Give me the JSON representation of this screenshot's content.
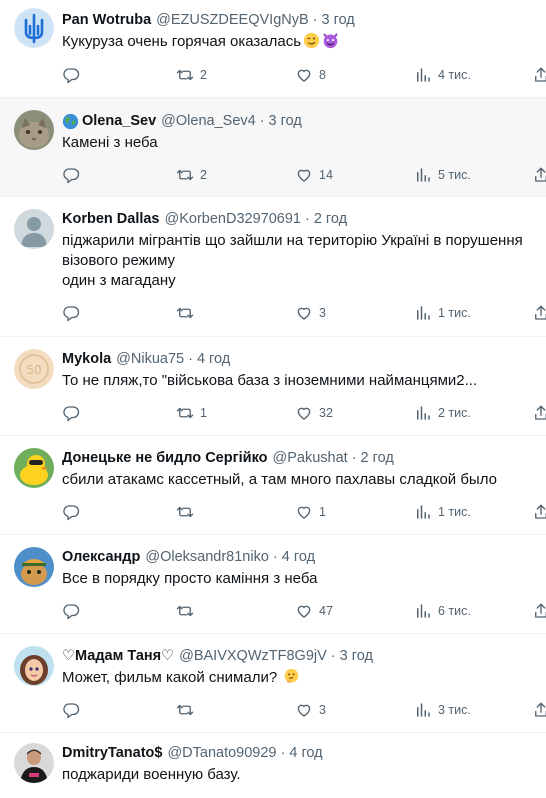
{
  "replies": [
    {
      "name": "Pan Wotruba",
      "handle": "@EZUSZDEEQVIgNyB",
      "time": "3 год",
      "text": "Кукуруза очень горячая оказалась",
      "emojis": [
        "winking-face",
        "smiling-devil"
      ],
      "avatar": "trident-avatar",
      "stats": {
        "replies": "",
        "retweets": "2",
        "likes": "8",
        "views": "4 тис."
      }
    },
    {
      "name": "Olena_Sev",
      "name_prefix_icon": "globe-icon",
      "handle": "@Olena_Sev4",
      "time": "3 год",
      "text": "Камені з неба",
      "avatar": "cat-avatar",
      "stats": {
        "replies": "",
        "retweets": "2",
        "likes": "14",
        "views": "5 тис."
      }
    },
    {
      "name": "Korben Dallas",
      "handle": "@KorbenD32970691",
      "time": "2 год",
      "text": "піджарили мігрантів що зайшли на територію Україні в порушення візового режиму\nодин з магадану",
      "avatar": "default-avatar",
      "stats": {
        "replies": "",
        "retweets": "",
        "likes": "3",
        "views": "1 тис."
      }
    },
    {
      "name": "Mykola",
      "handle": "@Nikua75",
      "time": "4 год",
      "text": "То не пляж,то \"військова база з іноземними найманцями2...",
      "avatar": "coin-avatar",
      "stats": {
        "replies": "",
        "retweets": "1",
        "likes": "32",
        "views": "2 тис."
      }
    },
    {
      "name": "Донецьке не бидло Сергійко",
      "handle": "@Pakushat",
      "time": "2 год",
      "text": "сбили атакамс кассетный, а там много пахлавы сладкой было",
      "avatar": "duck-avatar",
      "stats": {
        "replies": "",
        "retweets": "",
        "likes": "1",
        "views": "1 тис."
      }
    },
    {
      "name": "Олександр",
      "handle": "@Oleksandr81niko",
      "time": "4 год",
      "text": "Все в порядку просто каміння з неба",
      "avatar": "cat-cap-avatar",
      "stats": {
        "replies": "",
        "retweets": "",
        "likes": "47",
        "views": "6 тис."
      }
    },
    {
      "name": "♡Мадам Таня♡",
      "handle": "@BAIVXQWzTF8G9jV",
      "time": "3 год",
      "text": "Может, фильм какой снимали?",
      "emojis": [
        "thinking-face"
      ],
      "avatar": "girl-avatar",
      "stats": {
        "replies": "",
        "retweets": "",
        "likes": "3",
        "views": "3 тис."
      }
    },
    {
      "name": "DmitryTanato$",
      "handle": "@DTanato90929",
      "time": "4 год",
      "text": "поджариди военную базу.",
      "avatar": "man-avatar",
      "stats": null
    }
  ],
  "separator": "·",
  "colors": {
    "muted": "#536471",
    "text": "#0f1419",
    "highlight_bg": "#f7f7f7",
    "border": "#eff3f4"
  }
}
